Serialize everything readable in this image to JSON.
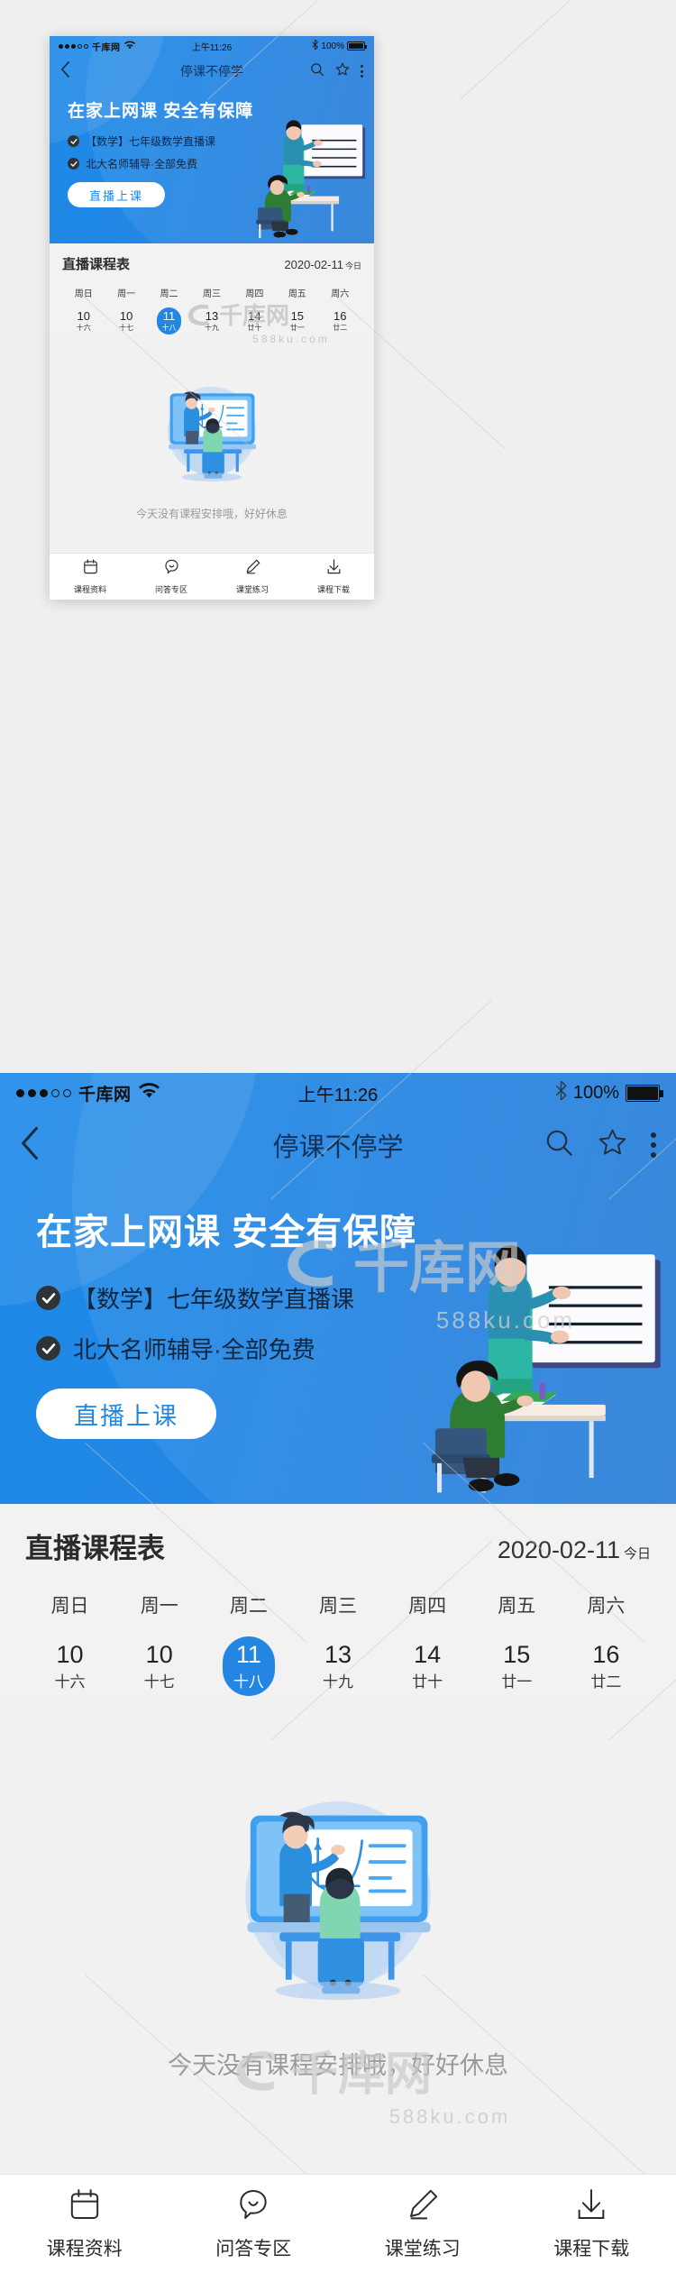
{
  "status_bar": {
    "signal_dots_filled": 3,
    "signal_dots_total": 5,
    "carrier": "千库网",
    "wifi_icon": "wifi-icon",
    "time": "上午11:26",
    "bluetooth_icon": "bluetooth-icon",
    "battery_percent": "100%"
  },
  "nav_bar": {
    "back_icon": "chevron-left-icon",
    "title": "停课不停学",
    "search_icon": "search-icon",
    "favorite_icon": "star-icon",
    "more_icon": "more-vertical-icon"
  },
  "hero": {
    "title": "在家上网课 安全有保障",
    "bullets": [
      "【数学】七年级数学直播课",
      "北大名师辅导·全部免费"
    ],
    "cta_label": "直播上课",
    "illustration": "teacher-whiteboard-student-desk-illustration",
    "bg_color": "#2486e3"
  },
  "schedule": {
    "title": "直播课程表",
    "date": "2020-02-11",
    "today_label": "今日",
    "days": [
      {
        "weekday": "周日",
        "day": "10",
        "lunar": "十六",
        "active": false
      },
      {
        "weekday": "周一",
        "day": "10",
        "lunar": "十七",
        "active": false
      },
      {
        "weekday": "周二",
        "day": "11",
        "lunar": "十八",
        "active": true
      },
      {
        "weekday": "周三",
        "day": "13",
        "lunar": "十九",
        "active": false
      },
      {
        "weekday": "周四",
        "day": "14",
        "lunar": "廿十",
        "active": false
      },
      {
        "weekday": "周五",
        "day": "15",
        "lunar": "廿一",
        "active": false
      },
      {
        "weekday": "周六",
        "day": "16",
        "lunar": "廿二",
        "active": false
      }
    ],
    "active_color": "#2486e3"
  },
  "empty_state": {
    "illustration": "online-class-empty-illustration",
    "text": "今天没有课程安排哦，好好休息"
  },
  "tabbar": {
    "items": [
      {
        "icon": "calendar-icon",
        "label": "课程资料"
      },
      {
        "icon": "chat-smile-icon",
        "label": "问答专区"
      },
      {
        "icon": "pencil-icon",
        "label": "课堂练习"
      },
      {
        "icon": "download-icon",
        "label": "课程下载"
      }
    ]
  },
  "watermark": {
    "brand": "千库网",
    "url": "588ku.com"
  }
}
